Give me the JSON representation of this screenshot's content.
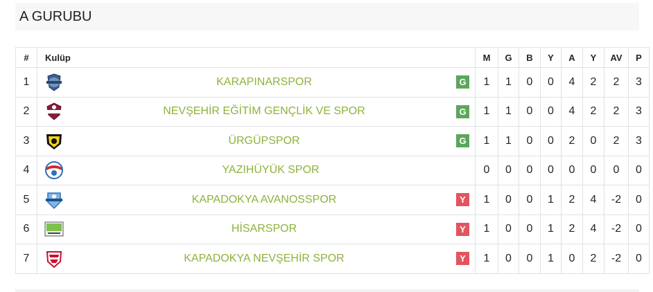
{
  "group": {
    "title": "A GURUBU"
  },
  "table": {
    "headers": {
      "rank": "#",
      "club": "Kulüp",
      "m": "M",
      "g": "G",
      "b": "B",
      "y": "Y",
      "a": "A",
      "y2": "Y",
      "av": "AV",
      "p": "P"
    },
    "rows": [
      {
        "rank": "1",
        "club": "KARAPINARSPOR",
        "logo": "karapinarspor-logo",
        "badge": "G",
        "badge_type": "g",
        "m": "1",
        "g": "1",
        "b": "0",
        "y": "0",
        "a": "4",
        "y2": "2",
        "av": "2",
        "p": "3"
      },
      {
        "rank": "2",
        "club": "NEVŞEHİR EĞİTİM GENÇLİK VE SPOR",
        "logo": "nevsehir-egitim-logo",
        "badge": "G",
        "badge_type": "g",
        "m": "1",
        "g": "1",
        "b": "0",
        "y": "0",
        "a": "4",
        "y2": "2",
        "av": "2",
        "p": "3"
      },
      {
        "rank": "3",
        "club": "ÜRGÜPSPOR",
        "logo": "urgupspor-logo",
        "badge": "G",
        "badge_type": "g",
        "m": "1",
        "g": "1",
        "b": "0",
        "y": "0",
        "a": "2",
        "y2": "0",
        "av": "2",
        "p": "3"
      },
      {
        "rank": "4",
        "club": "YAZIHÜYÜK SPOR",
        "logo": "yazihuyuk-logo",
        "badge": "",
        "badge_type": "",
        "m": "0",
        "g": "0",
        "b": "0",
        "y": "0",
        "a": "0",
        "y2": "0",
        "av": "0",
        "p": "0"
      },
      {
        "rank": "5",
        "club": "KAPADOKYA AVANOSSPOR",
        "logo": "avanosspor-logo",
        "badge": "Y",
        "badge_type": "y",
        "m": "1",
        "g": "0",
        "b": "0",
        "y": "1",
        "a": "2",
        "y2": "4",
        "av": "-2",
        "p": "0"
      },
      {
        "rank": "6",
        "club": "HİSARSPOR",
        "logo": "hisarspor-logo",
        "badge": "Y",
        "badge_type": "y",
        "m": "1",
        "g": "0",
        "b": "0",
        "y": "1",
        "a": "2",
        "y2": "4",
        "av": "-2",
        "p": "0"
      },
      {
        "rank": "7",
        "club": "KAPADOKYA NEVŞEHİR SPOR",
        "logo": "kapadokya-nevsehir-logo",
        "badge": "Y",
        "badge_type": "y",
        "m": "1",
        "g": "0",
        "b": "0",
        "y": "1",
        "a": "0",
        "y2": "2",
        "av": "-2",
        "p": "0"
      }
    ]
  },
  "colors": {
    "club_link": "#8cb33a",
    "win_badge": "#5ca65c",
    "loss_badge": "#e3545f",
    "header_bg": "#f7f7f7",
    "border": "#dee2e6"
  }
}
